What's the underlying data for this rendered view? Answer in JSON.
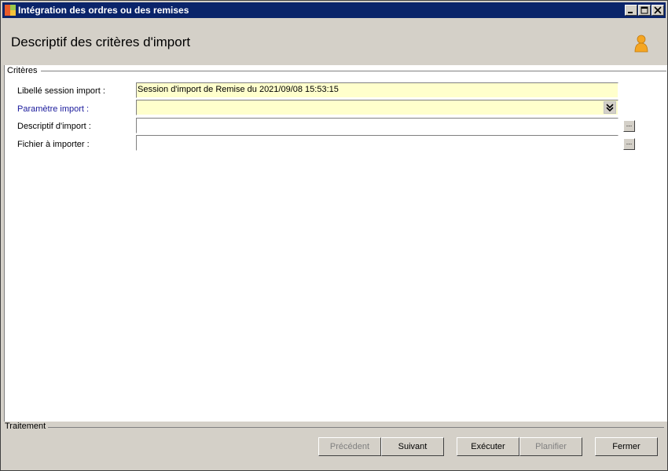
{
  "window": {
    "title": "Intégration des ordres ou des remises"
  },
  "header": {
    "title": "Descriptif des critères d'import"
  },
  "criteria": {
    "legend": "Critères",
    "fields": [
      {
        "label": "Libellé session import :",
        "value": "Session d'import de Remise du 2021/09/08 15:53:15"
      },
      {
        "label": "Paramètre import :",
        "value": ""
      },
      {
        "label": "Descriptif d'import :",
        "value": ""
      },
      {
        "label": "Fichier à importer :",
        "value": ""
      }
    ],
    "browse_label": "..."
  },
  "footer": {
    "legend": "Traitement",
    "buttons": {
      "previous": "Précédent",
      "next": "Suivant",
      "execute": "Exécuter",
      "schedule": "Planifier",
      "close": "Fermer"
    }
  },
  "colors": {
    "titlebar": "#0a246a",
    "field_yellow": "#ffffcc",
    "link_blue": "#1a1a9c"
  }
}
